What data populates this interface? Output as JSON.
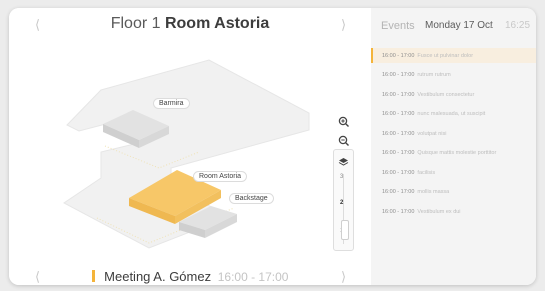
{
  "header": {
    "floor_label": "Floor 1",
    "room_name": "Room Astoria",
    "prev_icon": "chevron-left-icon",
    "next_icon": "chevron-right-icon"
  },
  "map": {
    "rooms": [
      "Barmira",
      "Room Astoria",
      "Backstage"
    ],
    "highlight_color": "#f7c768"
  },
  "controls": {
    "zoom_in_icon": "zoom-in-icon",
    "zoom_out_icon": "zoom-out-icon",
    "layers_icon": "layers-icon",
    "levels": [
      "3",
      "2",
      "1"
    ],
    "active_level": "2"
  },
  "meeting": {
    "name": "Meeting A. Gómez",
    "time": "16:00 - 17:00"
  },
  "events": {
    "title": "Events",
    "date": "Monday 17 Oct",
    "clock": "16:25",
    "accent": "#f4b43a",
    "items": [
      {
        "time": "16:00 - 17:00",
        "name": "Fusce ut pulvinar dolor"
      },
      {
        "time": "16:00 - 17:00",
        "name": "rutrum rutrum"
      },
      {
        "time": "16:00 - 17:00",
        "name": "Vestibulum consectetur"
      },
      {
        "time": "16:00 - 17:00",
        "name": "nunc malesuada, ut suscipit"
      },
      {
        "time": "16:00 - 17:00",
        "name": "volutpat nisi"
      },
      {
        "time": "16:00 - 17:00",
        "name": "Quisque mattis molestie porttitor"
      },
      {
        "time": "16:00 - 17:00",
        "name": "facilisis"
      },
      {
        "time": "16:00 - 17:00",
        "name": "mollis massa"
      },
      {
        "time": "16:00 - 17:00",
        "name": "Vestibulum ex dui"
      }
    ]
  }
}
